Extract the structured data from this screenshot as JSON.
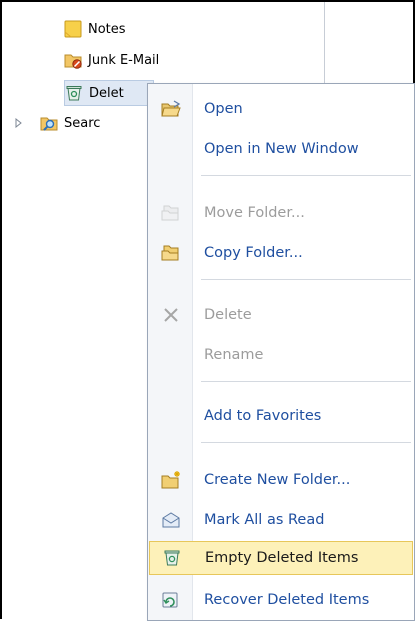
{
  "folder_tree": {
    "items": [
      {
        "label": "Notes",
        "icon": "notes-icon"
      },
      {
        "label": "Junk E-Mail",
        "icon": "junk-mail-icon"
      },
      {
        "label": "Delet",
        "icon": "deleted-items-icon",
        "selected": true
      },
      {
        "label": "Searc",
        "icon": "search-folder-icon",
        "expander": "collapsed"
      }
    ]
  },
  "context_menu": {
    "items": [
      {
        "label": "Open",
        "icon": "open-folder-icon",
        "enabled": true
      },
      {
        "label": "Open in New Window",
        "enabled": true
      },
      {
        "label": "Move Folder...",
        "icon": "move-folder-icon",
        "enabled": false
      },
      {
        "label": "Copy Folder...",
        "icon": "copy-folder-icon",
        "enabled": true
      },
      {
        "label": "Delete",
        "icon": "delete-x-icon",
        "enabled": false
      },
      {
        "label": "Rename",
        "enabled": false
      },
      {
        "label": "Add to Favorites",
        "enabled": true
      },
      {
        "label": "Create New Folder...",
        "icon": "new-folder-icon",
        "enabled": true
      },
      {
        "label": "Mark All as Read",
        "icon": "mark-read-icon",
        "enabled": true
      },
      {
        "label": "Empty Deleted Items",
        "icon": "empty-deleted-icon",
        "enabled": true,
        "highlighted": true
      },
      {
        "label": "Recover Deleted Items",
        "icon": "recover-deleted-icon",
        "enabled": true
      }
    ]
  },
  "colors": {
    "menu_text": "#1f4fa0",
    "disabled_text": "#9c9c9c",
    "highlight_bg": "#fdf1b9",
    "selection_bg": "#dfe8f4"
  }
}
